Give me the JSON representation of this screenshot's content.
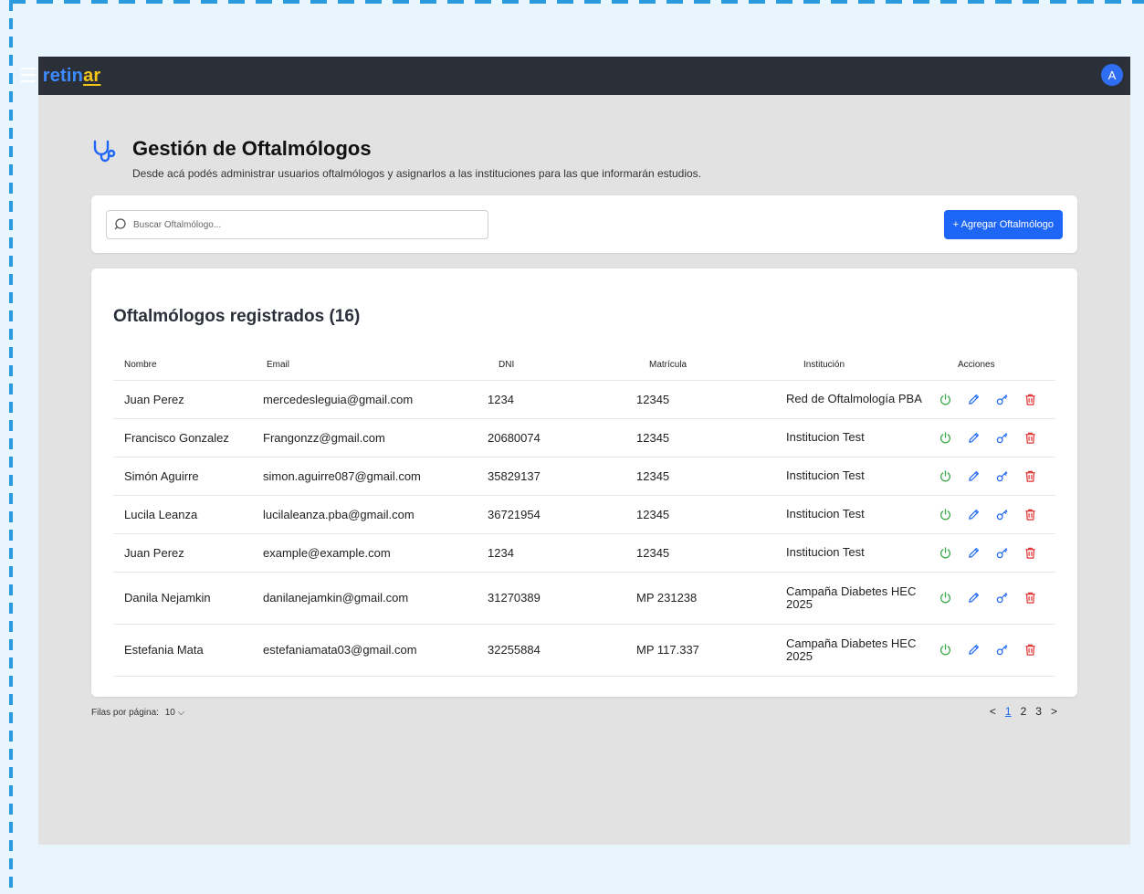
{
  "topbar": {
    "menu_icon": "☰",
    "brand_prefix": "retin",
    "brand_highlight": "ar",
    "avatar_initial": "A"
  },
  "header": {
    "icon": "stethoscope-icon",
    "title": "Gestión de Oftalmólogos",
    "description": "Desde acá podés administrar usuarios oftalmólogos y asignarlos a las instituciones para las que informarán estudios."
  },
  "toolbar": {
    "search_placeholder": "Buscar Oftalmólogo...",
    "add_label": "+ Agregar Oftalmólogo"
  },
  "table": {
    "title": "Oftalmólogos registrados (16)",
    "columns": [
      "Nombre",
      "Email",
      "DNI",
      "Matrícula",
      "Institución",
      "Acciones"
    ],
    "rows": [
      {
        "nombre": "Juan Perez",
        "email": "mercedesleguia@gmail.com",
        "dni": "1234",
        "matricula": "12345",
        "institucion": "Red de Oftalmología PBA"
      },
      {
        "nombre": "Francisco Gonzalez",
        "email": "Frangonzz@gmail.com",
        "dni": "20680074",
        "matricula": "12345",
        "institucion": "Institucion Test"
      },
      {
        "nombre": "Simón Aguirre",
        "email": "simon.aguirre087@gmail.com",
        "dni": "35829137",
        "matricula": "12345",
        "institucion": "Institucion Test"
      },
      {
        "nombre": "Lucila Leanza",
        "email": "lucilaleanza.pba@gmail.com",
        "dni": "36721954",
        "matricula": "12345",
        "institucion": "Institucion Test"
      },
      {
        "nombre": "Juan Perez",
        "email": "example@example.com",
        "dni": "1234",
        "matricula": "12345",
        "institucion": "Institucion Test"
      },
      {
        "nombre": "Danila Nejamkin",
        "email": "danilanejamkin@gmail.com",
        "dni": "31270389",
        "matricula": "MP 231238",
        "institucion": "Campaña Diabetes HEC 2025"
      },
      {
        "nombre": "Estefania Mata",
        "email": "estefaniamata03@gmail.com",
        "dni": "32255884",
        "matricula": "MP 117.337",
        "institucion": "Campaña Diabetes HEC 2025"
      }
    ],
    "action_icons": [
      "power-icon",
      "pencil-icon",
      "key-icon",
      "trash-icon"
    ]
  },
  "footer": {
    "rows_label": "Filas por página:",
    "rows_value": "10",
    "pages": [
      "1",
      "2",
      "3"
    ],
    "current_page": "1",
    "prev": "<",
    "next": ">"
  },
  "colors": {
    "primary": "#1e66f5",
    "topbar": "#2b2f38",
    "brand_accent": "#f5c518",
    "power": "#3aa84a",
    "edit": "#1e66f5",
    "delete": "#e03131"
  }
}
